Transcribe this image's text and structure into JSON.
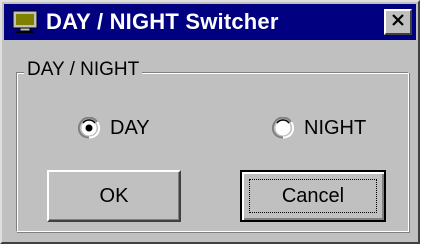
{
  "window": {
    "title": "DAY / NIGHT Switcher",
    "icon": "monitor-icon",
    "close_icon": "close-icon"
  },
  "group": {
    "label": "DAY / NIGHT"
  },
  "options": {
    "day": {
      "label": "DAY",
      "selected": true
    },
    "night": {
      "label": "NIGHT",
      "selected": false
    }
  },
  "buttons": {
    "ok_label": "OK",
    "cancel_label": "Cancel",
    "focused": "cancel"
  },
  "colors": {
    "titlebar": "#000080",
    "face": "#c0c0c0",
    "icon_accent": "#808000"
  }
}
